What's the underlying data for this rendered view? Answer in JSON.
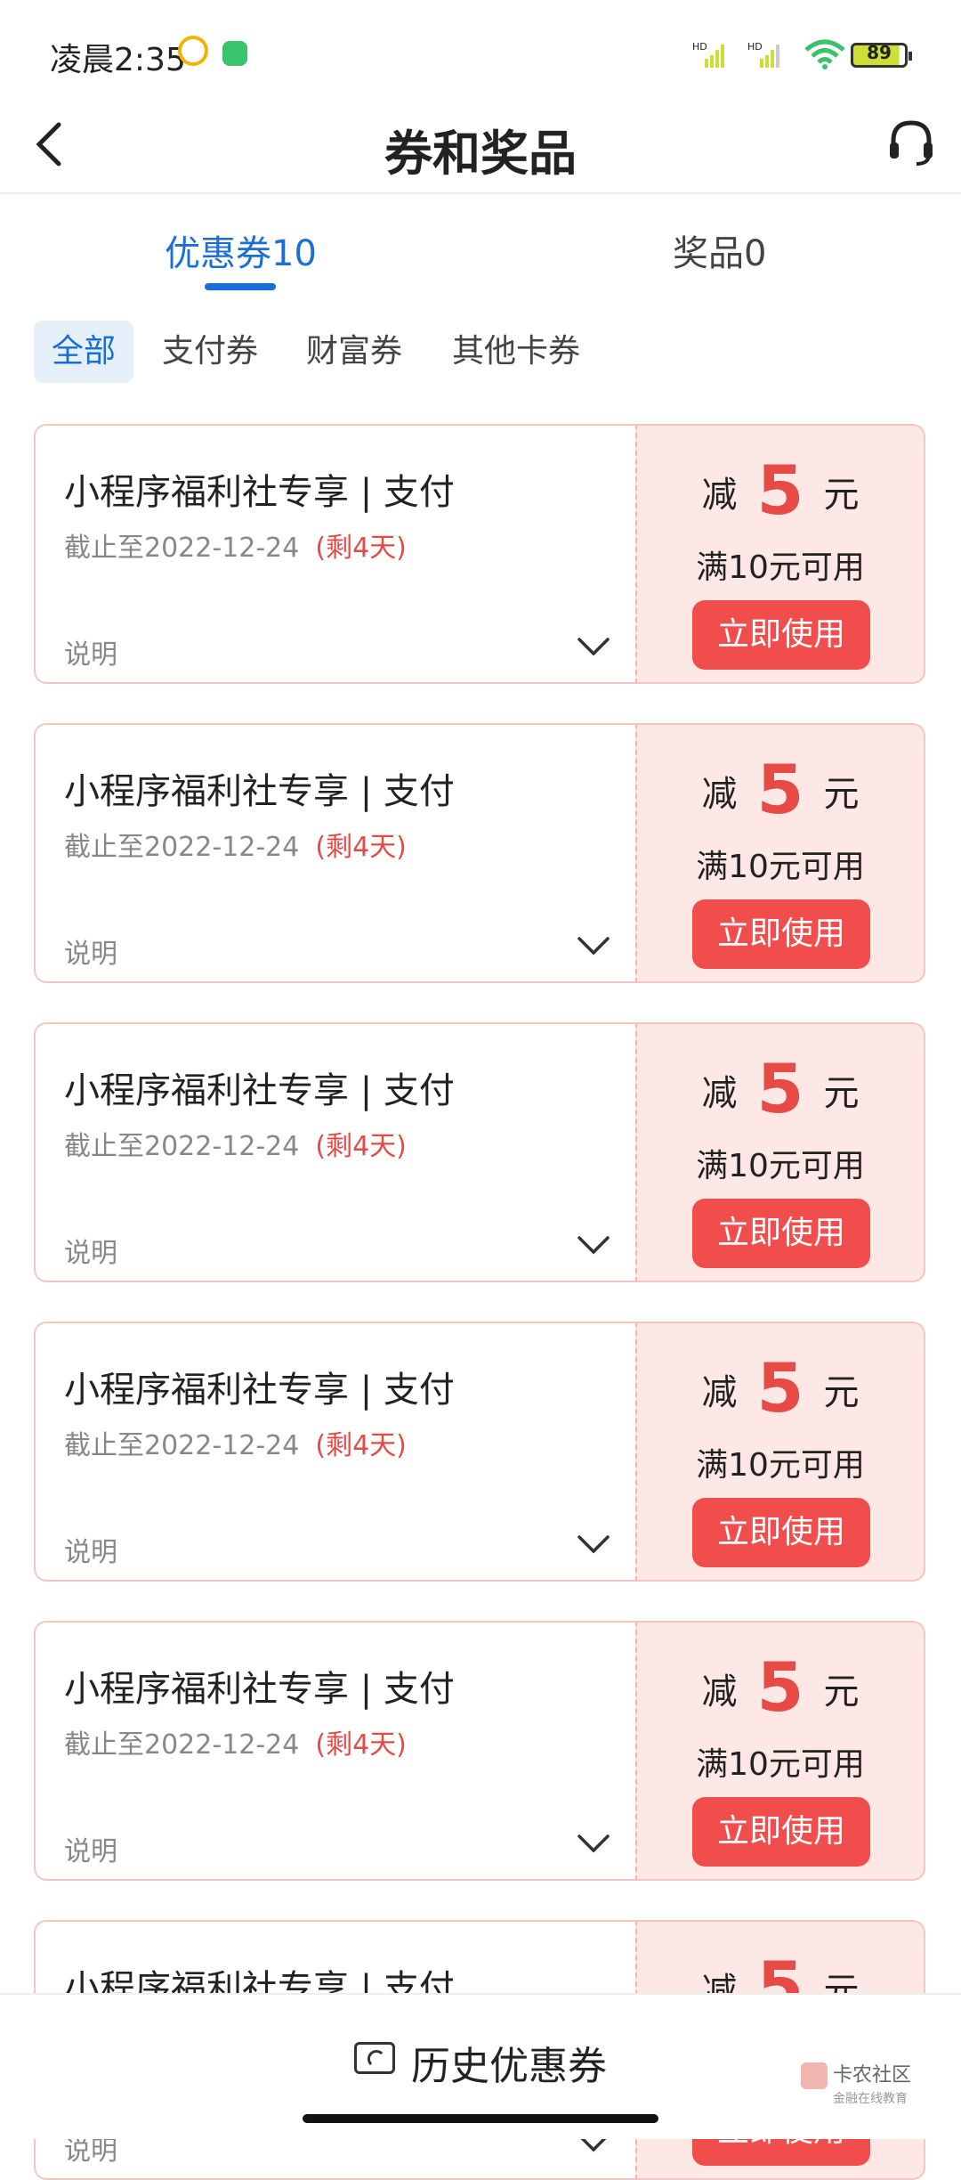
{
  "status": {
    "time": "凌晨2:35",
    "battery": "89",
    "net1": "HD",
    "net2": "HD"
  },
  "nav": {
    "title": "券和奖品"
  },
  "tabs": [
    {
      "label": "优惠券10"
    },
    {
      "label": "奖品0"
    }
  ],
  "chips": [
    {
      "label": "全部"
    },
    {
      "label": "支付券"
    },
    {
      "label": "财富券"
    },
    {
      "label": "其他卡券"
    }
  ],
  "coupon": {
    "name": "小程序福利社专享 | 支付",
    "expiry": "截止至2022-12-24",
    "remaining": "(剩4天)",
    "desc": "说明",
    "minus": "减",
    "amount": "5",
    "unit": "元",
    "condition": "满10元可用",
    "use": "立即使用"
  },
  "bottom": {
    "history": "历史优惠券",
    "watermark": "卡农社区",
    "watermark_sub": "金融在线教育"
  },
  "colors": {
    "accent": "#1a6fd6",
    "red": "#e64a45",
    "button": "#f24d4d",
    "coupon_bg": "#fde8e6"
  }
}
